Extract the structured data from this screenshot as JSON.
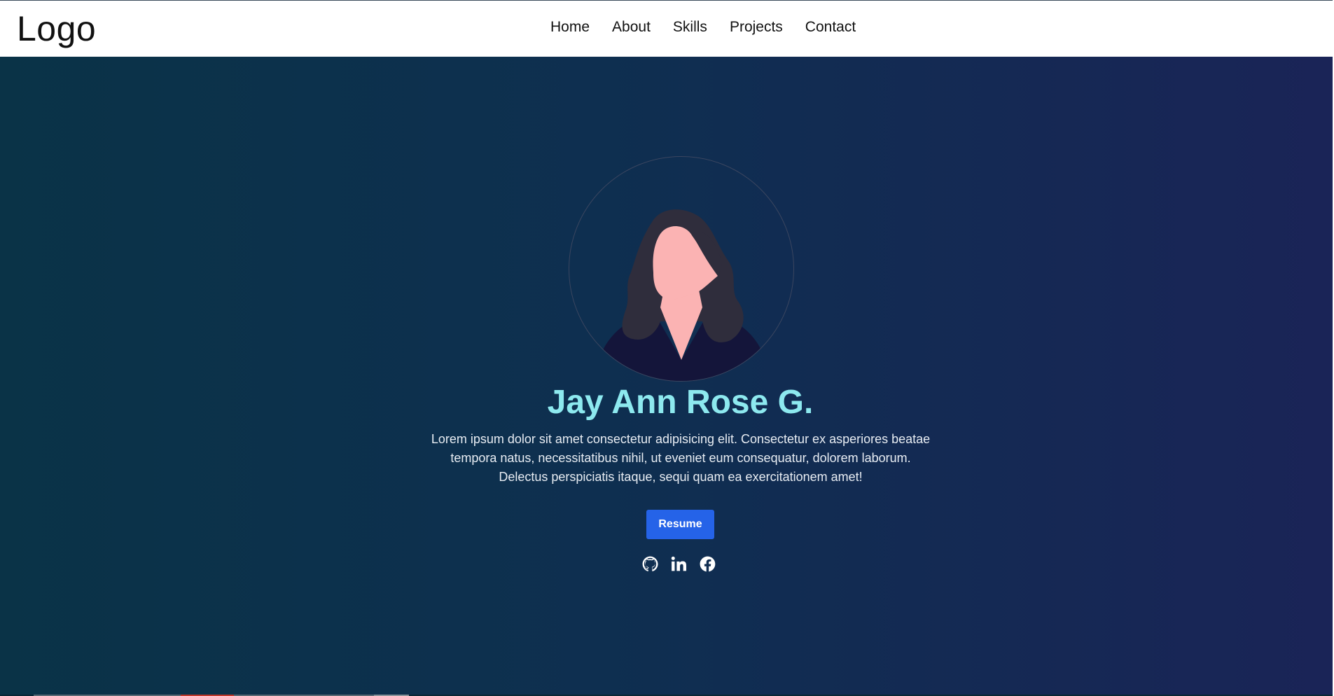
{
  "header": {
    "logo": "Logo",
    "nav": [
      "Home",
      "About",
      "Skills",
      "Projects",
      "Contact"
    ]
  },
  "hero": {
    "name": "Jay Ann Rose G.",
    "bio_lines": [
      "Lorem ipsum dolor sit amet consectetur adipisicing elit. Consectetur ex asperiores beatae",
      "tempora natus, necessitatibus nihil, ut eveniet eum consequatur, dolorem laborum.",
      "Delectus perspiciatis itaque, sequi quam ea exercitationem amet!"
    ],
    "resume_label": "Resume",
    "social_icons": [
      "github-icon",
      "linkedin-icon",
      "facebook-icon"
    ]
  },
  "colors": {
    "name_accent": "#8de9ef",
    "button": "#2563e8",
    "hero_gradient_start": "#0a3347",
    "hero_gradient_end": "#1a2457"
  }
}
